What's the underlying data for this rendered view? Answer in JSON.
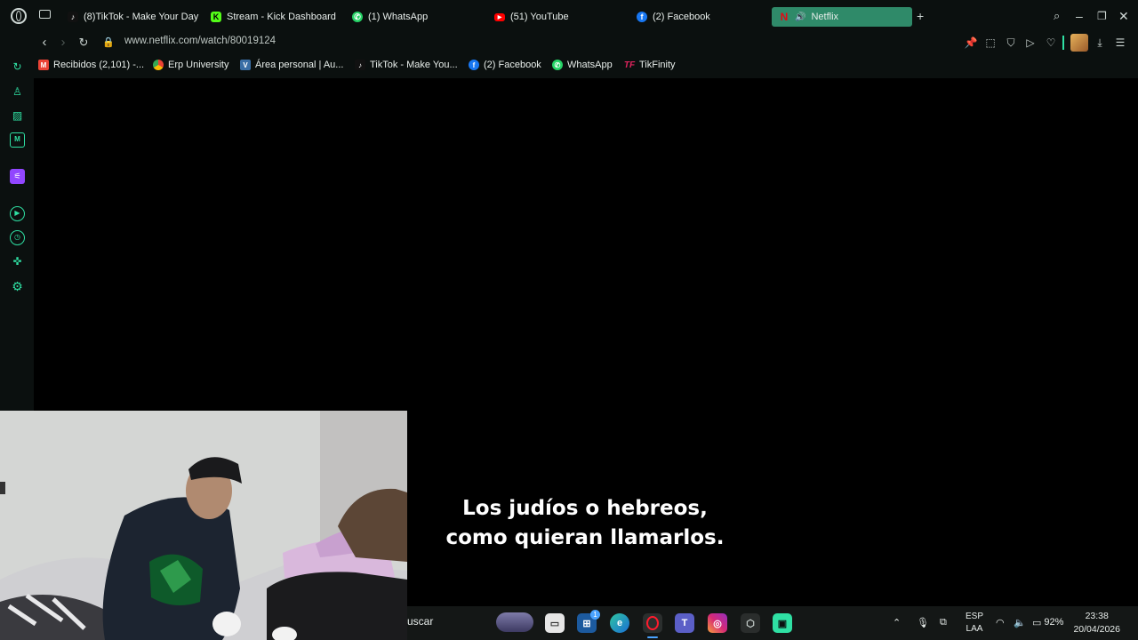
{
  "browser": {
    "tabs": [
      {
        "label": "(8)TikTok - Make Your Day",
        "icon": "tiktok-icon",
        "color": "#111111"
      },
      {
        "label": "Stream - Kick Dashboard",
        "icon": "kick-icon",
        "color": "#53fc18"
      },
      {
        "label": "(1) WhatsApp",
        "icon": "whatsapp-icon",
        "color": "#25d366"
      },
      {
        "label": "(51) YouTube",
        "icon": "youtube-icon",
        "color": "#ff0000"
      },
      {
        "label": "(2) Facebook",
        "icon": "facebook-icon",
        "color": "#1877f2"
      },
      {
        "label": "Netflix",
        "icon": "netflix-icon",
        "color": "#e50914"
      }
    ],
    "active_tab": "Netflix",
    "accent": "#2f8a69",
    "url": "www.netflix.com/watch/80019124",
    "bookmarks": [
      {
        "label": "Recibidos (2,101) -...",
        "icon": "gmail-icon",
        "color": "#ea4335"
      },
      {
        "label": "Erp University",
        "icon": "chrome-icon",
        "color": "#fbbc04"
      },
      {
        "label": "Área personal | Au...",
        "icon": "moodle-icon",
        "color": "#3a6ea5"
      },
      {
        "label": "TikTok - Make You...",
        "icon": "tiktok-icon",
        "color": "#111111"
      },
      {
        "label": "(2) Facebook",
        "icon": "facebook-icon",
        "color": "#1877f2"
      },
      {
        "label": "WhatsApp",
        "icon": "whatsapp-icon",
        "color": "#25d366"
      },
      {
        "label": "TikFinity",
        "icon": "tikfinity-icon",
        "color": "#e0245e"
      }
    ]
  },
  "video": {
    "subtitle_line1": "Los judíos o hebreos,",
    "subtitle_line2": "como quieran llamarlos."
  },
  "taskbar": {
    "search_text": "uscar",
    "badge_count": "1",
    "language": "ESP",
    "layout": "LAA",
    "battery": "92%",
    "time": "23:38",
    "date": "20/04/2026"
  }
}
